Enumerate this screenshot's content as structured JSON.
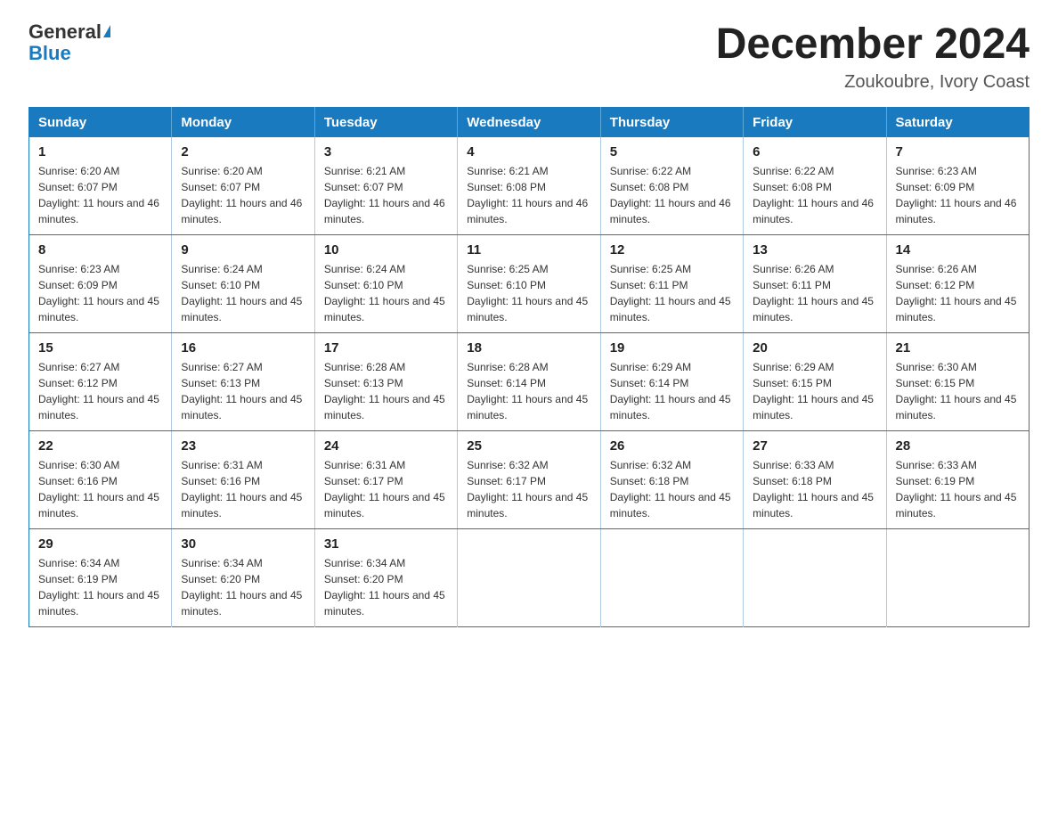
{
  "logo": {
    "general": "General",
    "triangle": "",
    "blue": "Blue"
  },
  "header": {
    "month_title": "December 2024",
    "location": "Zoukoubre, Ivory Coast"
  },
  "weekdays": [
    "Sunday",
    "Monday",
    "Tuesday",
    "Wednesday",
    "Thursday",
    "Friday",
    "Saturday"
  ],
  "weeks": [
    [
      {
        "day": "1",
        "sunrise": "6:20 AM",
        "sunset": "6:07 PM",
        "daylight": "11 hours and 46 minutes."
      },
      {
        "day": "2",
        "sunrise": "6:20 AM",
        "sunset": "6:07 PM",
        "daylight": "11 hours and 46 minutes."
      },
      {
        "day": "3",
        "sunrise": "6:21 AM",
        "sunset": "6:07 PM",
        "daylight": "11 hours and 46 minutes."
      },
      {
        "day": "4",
        "sunrise": "6:21 AM",
        "sunset": "6:08 PM",
        "daylight": "11 hours and 46 minutes."
      },
      {
        "day": "5",
        "sunrise": "6:22 AM",
        "sunset": "6:08 PM",
        "daylight": "11 hours and 46 minutes."
      },
      {
        "day": "6",
        "sunrise": "6:22 AM",
        "sunset": "6:08 PM",
        "daylight": "11 hours and 46 minutes."
      },
      {
        "day": "7",
        "sunrise": "6:23 AM",
        "sunset": "6:09 PM",
        "daylight": "11 hours and 46 minutes."
      }
    ],
    [
      {
        "day": "8",
        "sunrise": "6:23 AM",
        "sunset": "6:09 PM",
        "daylight": "11 hours and 45 minutes."
      },
      {
        "day": "9",
        "sunrise": "6:24 AM",
        "sunset": "6:10 PM",
        "daylight": "11 hours and 45 minutes."
      },
      {
        "day": "10",
        "sunrise": "6:24 AM",
        "sunset": "6:10 PM",
        "daylight": "11 hours and 45 minutes."
      },
      {
        "day": "11",
        "sunrise": "6:25 AM",
        "sunset": "6:10 PM",
        "daylight": "11 hours and 45 minutes."
      },
      {
        "day": "12",
        "sunrise": "6:25 AM",
        "sunset": "6:11 PM",
        "daylight": "11 hours and 45 minutes."
      },
      {
        "day": "13",
        "sunrise": "6:26 AM",
        "sunset": "6:11 PM",
        "daylight": "11 hours and 45 minutes."
      },
      {
        "day": "14",
        "sunrise": "6:26 AM",
        "sunset": "6:12 PM",
        "daylight": "11 hours and 45 minutes."
      }
    ],
    [
      {
        "day": "15",
        "sunrise": "6:27 AM",
        "sunset": "6:12 PM",
        "daylight": "11 hours and 45 minutes."
      },
      {
        "day": "16",
        "sunrise": "6:27 AM",
        "sunset": "6:13 PM",
        "daylight": "11 hours and 45 minutes."
      },
      {
        "day": "17",
        "sunrise": "6:28 AM",
        "sunset": "6:13 PM",
        "daylight": "11 hours and 45 minutes."
      },
      {
        "day": "18",
        "sunrise": "6:28 AM",
        "sunset": "6:14 PM",
        "daylight": "11 hours and 45 minutes."
      },
      {
        "day": "19",
        "sunrise": "6:29 AM",
        "sunset": "6:14 PM",
        "daylight": "11 hours and 45 minutes."
      },
      {
        "day": "20",
        "sunrise": "6:29 AM",
        "sunset": "6:15 PM",
        "daylight": "11 hours and 45 minutes."
      },
      {
        "day": "21",
        "sunrise": "6:30 AM",
        "sunset": "6:15 PM",
        "daylight": "11 hours and 45 minutes."
      }
    ],
    [
      {
        "day": "22",
        "sunrise": "6:30 AM",
        "sunset": "6:16 PM",
        "daylight": "11 hours and 45 minutes."
      },
      {
        "day": "23",
        "sunrise": "6:31 AM",
        "sunset": "6:16 PM",
        "daylight": "11 hours and 45 minutes."
      },
      {
        "day": "24",
        "sunrise": "6:31 AM",
        "sunset": "6:17 PM",
        "daylight": "11 hours and 45 minutes."
      },
      {
        "day": "25",
        "sunrise": "6:32 AM",
        "sunset": "6:17 PM",
        "daylight": "11 hours and 45 minutes."
      },
      {
        "day": "26",
        "sunrise": "6:32 AM",
        "sunset": "6:18 PM",
        "daylight": "11 hours and 45 minutes."
      },
      {
        "day": "27",
        "sunrise": "6:33 AM",
        "sunset": "6:18 PM",
        "daylight": "11 hours and 45 minutes."
      },
      {
        "day": "28",
        "sunrise": "6:33 AM",
        "sunset": "6:19 PM",
        "daylight": "11 hours and 45 minutes."
      }
    ],
    [
      {
        "day": "29",
        "sunrise": "6:34 AM",
        "sunset": "6:19 PM",
        "daylight": "11 hours and 45 minutes."
      },
      {
        "day": "30",
        "sunrise": "6:34 AM",
        "sunset": "6:20 PM",
        "daylight": "11 hours and 45 minutes."
      },
      {
        "day": "31",
        "sunrise": "6:34 AM",
        "sunset": "6:20 PM",
        "daylight": "11 hours and 45 minutes."
      },
      null,
      null,
      null,
      null
    ]
  ]
}
